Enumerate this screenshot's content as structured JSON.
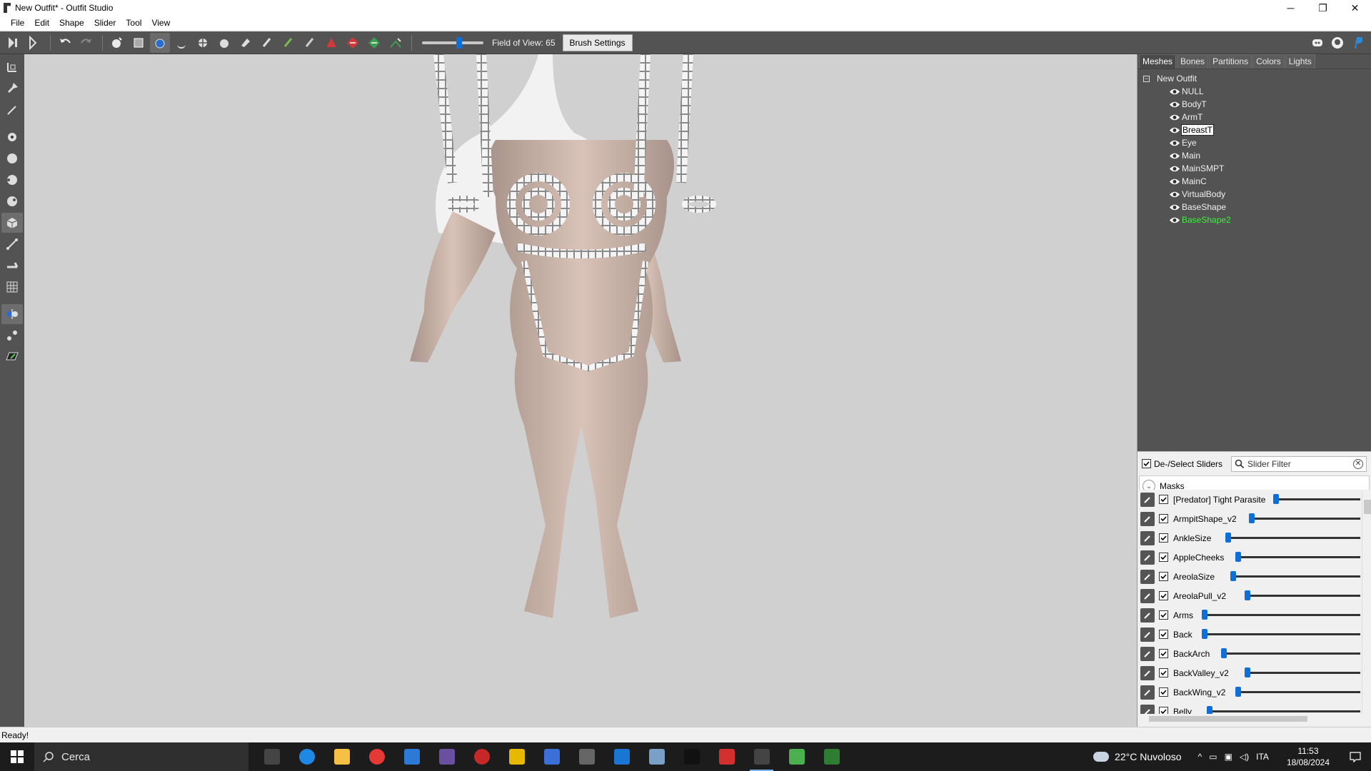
{
  "window": {
    "title": "New Outfit* - Outfit Studio",
    "minimize_glyph": "─",
    "restore_glyph": "❐",
    "close_glyph": "✕"
  },
  "menubar": [
    "File",
    "Edit",
    "Shape",
    "Slider",
    "Tool",
    "View"
  ],
  "toolbar": {
    "fov_label": "Field of View: 65",
    "fov_value": 65,
    "brush_settings_label": "Brush Settings"
  },
  "panel": {
    "tabs": [
      "Meshes",
      "Bones",
      "Partitions",
      "Colors",
      "Lights"
    ],
    "active_tab": "Meshes",
    "tree_root": "New Outfit",
    "tree_collapse_glyph": "−",
    "meshes": [
      {
        "name": "NULL",
        "state": "normal"
      },
      {
        "name": "BodyT",
        "state": "normal"
      },
      {
        "name": "ArmT",
        "state": "normal"
      },
      {
        "name": "BreastT",
        "state": "selected"
      },
      {
        "name": "Eye",
        "state": "normal"
      },
      {
        "name": "Main",
        "state": "normal"
      },
      {
        "name": "MainSMPT",
        "state": "normal"
      },
      {
        "name": "MainC",
        "state": "normal"
      },
      {
        "name": "VirtualBody",
        "state": "normal"
      },
      {
        "name": "BaseShape",
        "state": "normal"
      },
      {
        "name": "BaseShape2",
        "state": "highlight"
      }
    ],
    "deselect_label": "De-/Select Sliders",
    "slider_filter_placeholder": "Slider Filter",
    "masks_label": "Masks",
    "sliders": [
      {
        "name": "[Predator] Tight Parasite",
        "checked": true,
        "value": 0.0
      },
      {
        "name": "ArmpitShape_v2",
        "checked": true,
        "value": 0.0
      },
      {
        "name": "AnkleSize",
        "checked": true,
        "value": 0.0
      },
      {
        "name": "AppleCheeks",
        "checked": true,
        "value": 0.0
      },
      {
        "name": "AreolaSize",
        "checked": true,
        "value": 0.0
      },
      {
        "name": "AreolaPull_v2",
        "checked": true,
        "value": 0.0
      },
      {
        "name": "Arms",
        "checked": true,
        "value": 0.0
      },
      {
        "name": "Back",
        "checked": true,
        "value": 0.0
      },
      {
        "name": "BackArch",
        "checked": true,
        "value": 0.0
      },
      {
        "name": "BackValley_v2",
        "checked": true,
        "value": 0.0
      },
      {
        "name": "BackWing_v2",
        "checked": true,
        "value": 0.0
      },
      {
        "name": "Belly",
        "checked": true,
        "value": 0.0
      }
    ]
  },
  "status": "Ready!",
  "taskbar": {
    "search_label": "Cerca",
    "weather": "22°C  Nuvoloso",
    "language": "ITA",
    "time": "11:53",
    "date": "18/08/2024",
    "apps": [
      "task-view",
      "edge",
      "file-explorer",
      "opera",
      "app-blue",
      "app-gamebar",
      "app-red-circle",
      "app-yellow",
      "app-feather",
      "app-tools",
      "app-store",
      "app-paint",
      "app-black",
      "app-f",
      "outfit-studio",
      "app-green-1",
      "app-green-2"
    ]
  }
}
